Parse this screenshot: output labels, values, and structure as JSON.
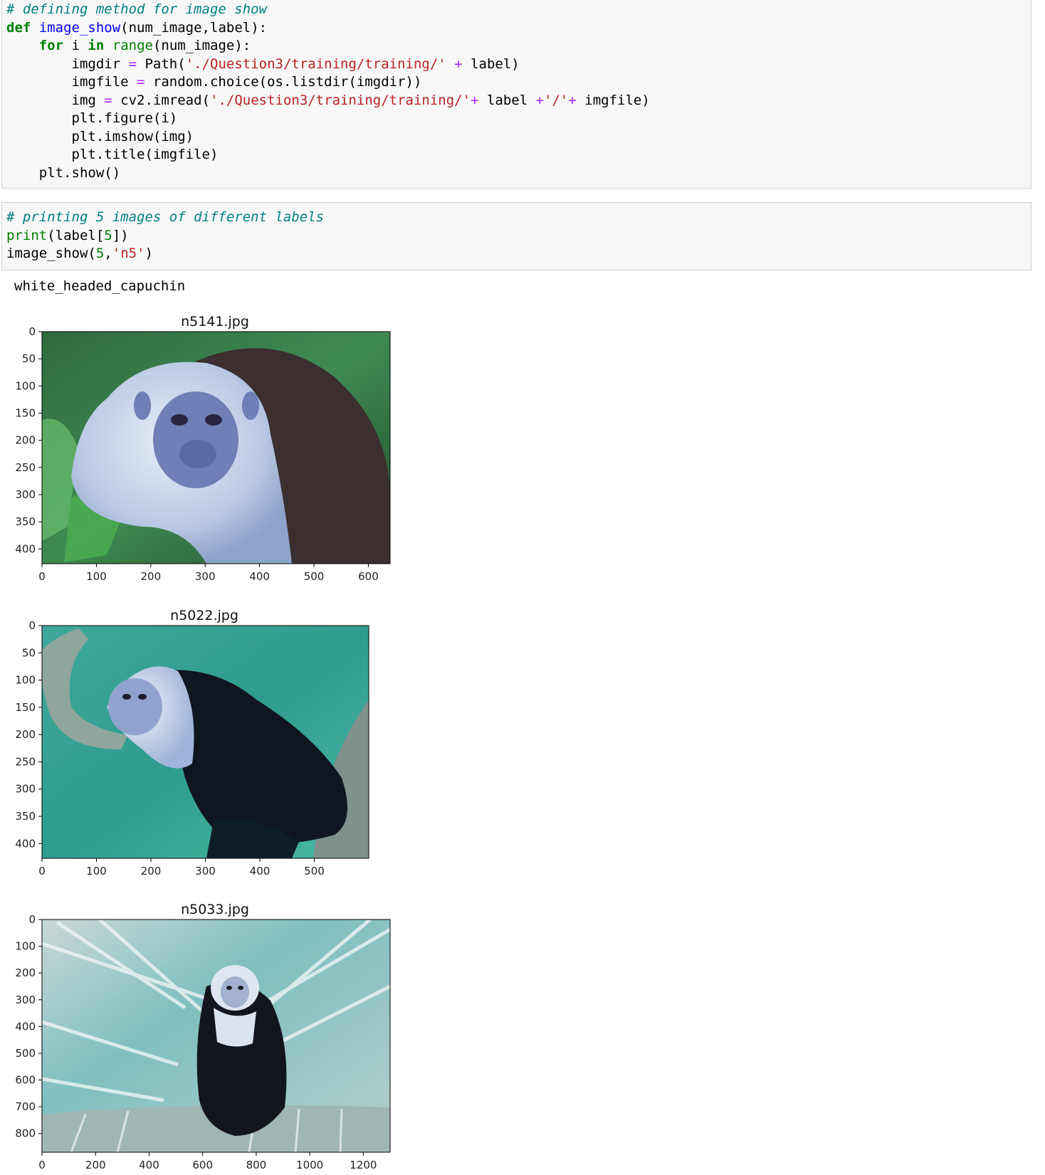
{
  "cell1": {
    "lines": [
      [
        [
          "cm",
          "# defining method for image show"
        ]
      ],
      [
        [
          "kw",
          "def"
        ],
        [
          "",
          " "
        ],
        [
          "fn",
          "image_show"
        ],
        [
          "",
          "(num_image,label):"
        ]
      ],
      [
        [
          "",
          "    "
        ],
        [
          "kw",
          "for"
        ],
        [
          "",
          " i "
        ],
        [
          "kw",
          "in"
        ],
        [
          "",
          " "
        ],
        [
          "bi",
          "range"
        ],
        [
          "",
          "(num_image):"
        ]
      ],
      [
        [
          "",
          "        imgdir "
        ],
        [
          "op",
          "="
        ],
        [
          "",
          " Path("
        ],
        [
          "st",
          "'./Question3/training/training/'"
        ],
        [
          "",
          " "
        ],
        [
          "op",
          "+"
        ],
        [
          "",
          " label)"
        ]
      ],
      [
        [
          "",
          "        imgfile "
        ],
        [
          "op",
          "="
        ],
        [
          "",
          " random.choice(os.listdir(imgdir))"
        ]
      ],
      [
        [
          "",
          "        img "
        ],
        [
          "op",
          "="
        ],
        [
          "",
          " cv2.imread("
        ],
        [
          "st",
          "'./Question3/training/training/'"
        ],
        [
          "op",
          "+"
        ],
        [
          "",
          " label "
        ],
        [
          "op",
          "+"
        ],
        [
          "st",
          "'/'"
        ],
        [
          "op",
          "+"
        ],
        [
          "",
          " imgfile)"
        ]
      ],
      [
        [
          "",
          "        plt.figure(i)"
        ]
      ],
      [
        [
          "",
          "        plt.imshow(img)"
        ]
      ],
      [
        [
          "",
          "        plt.title(imgfile)"
        ]
      ],
      [
        [
          "",
          "    plt.show()"
        ]
      ]
    ]
  },
  "cell2": {
    "lines": [
      [
        [
          "cm",
          "# printing 5 images of different labels"
        ]
      ],
      [
        [
          "bi",
          "print"
        ],
        [
          "",
          "(label["
        ],
        [
          "nm",
          "5"
        ],
        [
          "",
          "])"
        ]
      ],
      [
        [
          "",
          "image_show("
        ],
        [
          "nm",
          "5"
        ],
        [
          "",
          ","
        ],
        [
          "st",
          "'n5'"
        ],
        [
          "",
          ")"
        ]
      ]
    ]
  },
  "output": {
    "stdout": "white_headed_capuchin"
  },
  "colors": {
    "comment": "#008080",
    "keyword": "#008000",
    "function": "#0000ff",
    "string": "#ba2121",
    "operator": "#aa22ff"
  },
  "chart_data": [
    {
      "type": "image",
      "title": "n5141.jpg",
      "image_width": 640,
      "image_height": 427,
      "xticks": [
        0,
        100,
        200,
        300,
        400,
        500,
        600
      ],
      "yticks": [
        0,
        50,
        100,
        150,
        200,
        250,
        300,
        350,
        400
      ]
    },
    {
      "type": "image",
      "title": "n5022.jpg",
      "image_width": 600,
      "image_height": 427,
      "xticks": [
        0,
        100,
        200,
        300,
        400,
        500
      ],
      "yticks": [
        0,
        50,
        100,
        150,
        200,
        250,
        300,
        350,
        400
      ]
    },
    {
      "type": "image",
      "title": "n5033.jpg",
      "image_width": 1300,
      "image_height": 870,
      "xticks": [
        0,
        200,
        400,
        600,
        800,
        1000,
        1200
      ],
      "yticks": [
        0,
        100,
        200,
        300,
        400,
        500,
        600,
        700,
        800
      ]
    }
  ]
}
